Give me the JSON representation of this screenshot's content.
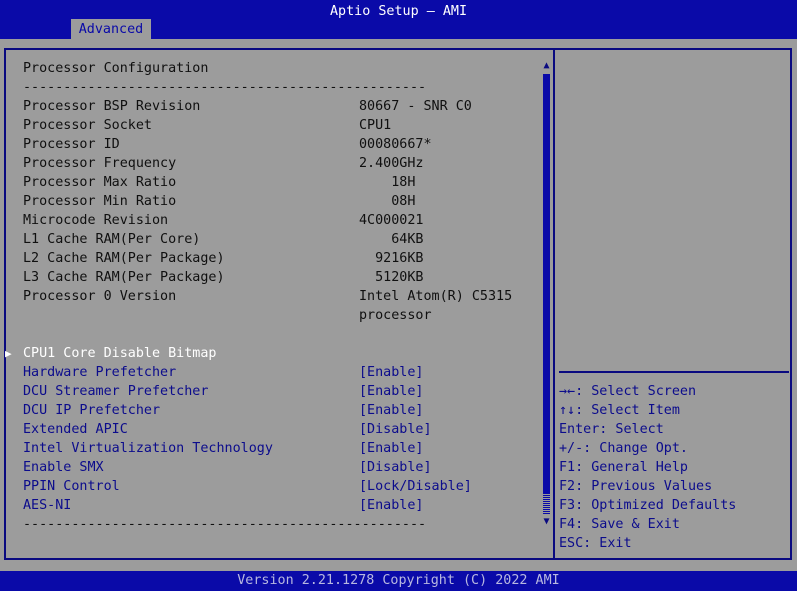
{
  "header": {
    "title": "Aptio Setup – AMI",
    "tabs": [
      {
        "label": "Advanced",
        "active": true
      }
    ]
  },
  "main": {
    "section_title": "Processor Configuration",
    "separator": "--------------------------------------------------",
    "info_rows": [
      {
        "label": "Processor BSP Revision",
        "value": "80667 - SNR C0"
      },
      {
        "label": "Processor Socket",
        "value": "CPU1"
      },
      {
        "label": "Processor ID",
        "value": "00080667*"
      },
      {
        "label": "Processor Frequency",
        "value": "2.400GHz"
      },
      {
        "label": "Processor Max Ratio",
        "value": "    18H"
      },
      {
        "label": "Processor Min Ratio",
        "value": "    08H"
      },
      {
        "label": "Microcode Revision",
        "value": "4C000021"
      },
      {
        "label": "L1 Cache RAM(Per Core)",
        "value": "    64KB"
      },
      {
        "label": "L2 Cache RAM(Per Package)",
        "value": "  9216KB"
      },
      {
        "label": "L3 Cache RAM(Per Package)",
        "value": "  5120KB"
      },
      {
        "label": "Processor 0 Version",
        "value": "Intel Atom(R) C5315"
      },
      {
        "label": "",
        "value": "processor"
      }
    ],
    "submenu": {
      "label": "CPU1 Core Disable Bitmap",
      "selected": true,
      "arrow": "▶"
    },
    "settings": [
      {
        "label": "Hardware Prefetcher",
        "value": "[Enable]"
      },
      {
        "label": "DCU Streamer Prefetcher",
        "value": "[Enable]"
      },
      {
        "label": "DCU IP Prefetcher",
        "value": "[Enable]"
      },
      {
        "label": "Extended APIC",
        "value": "[Disable]"
      },
      {
        "label": "Intel Virtualization Technology",
        "value": "[Enable]"
      },
      {
        "label": "Enable SMX",
        "value": "[Disable]"
      },
      {
        "label": "PPIN Control",
        "value": "[Lock/Disable]"
      },
      {
        "label": "AES-NI",
        "value": "[Enable]"
      }
    ],
    "bottom_separator": "--------------------------------------------------",
    "scrollbar": {
      "up_icon": "▲",
      "down_icon": "▼"
    }
  },
  "help_panel": {
    "description": "",
    "keys": [
      "→←: Select Screen",
      "↑↓: Select Item",
      "Enter: Select",
      "+/-: Change Opt.",
      "F1: General Help",
      "F2: Previous Values",
      "F3: Optimized Defaults",
      "F4: Save & Exit",
      "ESC: Exit"
    ]
  },
  "footer": {
    "text": "Version 2.21.1278 Copyright (C) 2022 AMI"
  },
  "colors": {
    "accent_blue": "#0a0aa8",
    "background_gray": "#9c9c9c",
    "selected_text": "#ffffff",
    "option_text": "#0c0c8c"
  }
}
